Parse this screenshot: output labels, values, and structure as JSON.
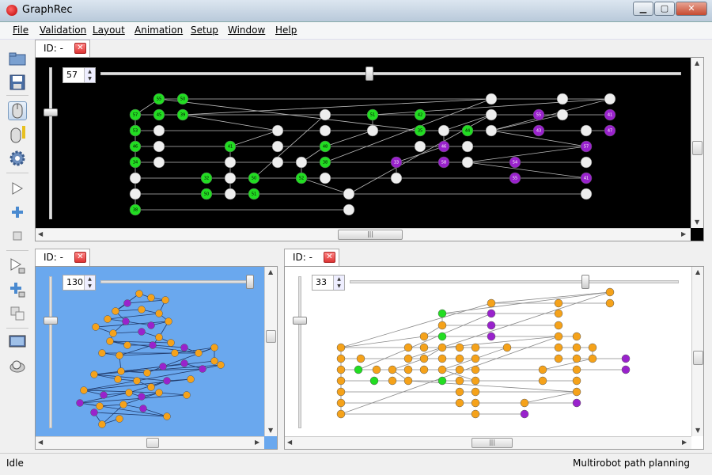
{
  "window": {
    "title": "GraphRec"
  },
  "menu": [
    "File",
    "Validation",
    "Layout",
    "Animation",
    "Setup",
    "Window",
    "Help"
  ],
  "toolbar": [
    "open-icon",
    "save-icon",
    "mouse-select-icon",
    "mouse-tool-icon",
    "settings-gear-icon",
    "play-icon",
    "add-icon",
    "stop-icon",
    "play-step-icon",
    "add-step-icon",
    "copy-icon",
    "monitor-icon",
    "magnifier-icon"
  ],
  "panels": {
    "top": {
      "tab": "ID: -",
      "spin": "57",
      "bg": "#000000"
    },
    "bottom_left": {
      "tab": "ID: -",
      "spin": "130",
      "bg": "#6aa8ee"
    },
    "bottom_right": {
      "tab": "ID: -",
      "spin": "33",
      "bg": "#ffffff"
    }
  },
  "status": {
    "left": "Idle",
    "right": "Multirobot path planning"
  },
  "colors": {
    "green": "#22dd22",
    "purple": "#9922cc",
    "orange": "#f5a21a",
    "white_node": "#eeeeee"
  },
  "top_labels": {
    "green": [
      "55",
      "50",
      "57",
      "45",
      "39",
      "51",
      "42",
      "53",
      "35",
      "44",
      "46",
      "41",
      "48",
      "34",
      "38",
      "32",
      "50",
      "52",
      "50",
      "51",
      "38",
      "42"
    ],
    "purple": [
      "55",
      "41",
      "43",
      "47",
      "46",
      "57",
      "33",
      "58",
      "54"
    ]
  }
}
